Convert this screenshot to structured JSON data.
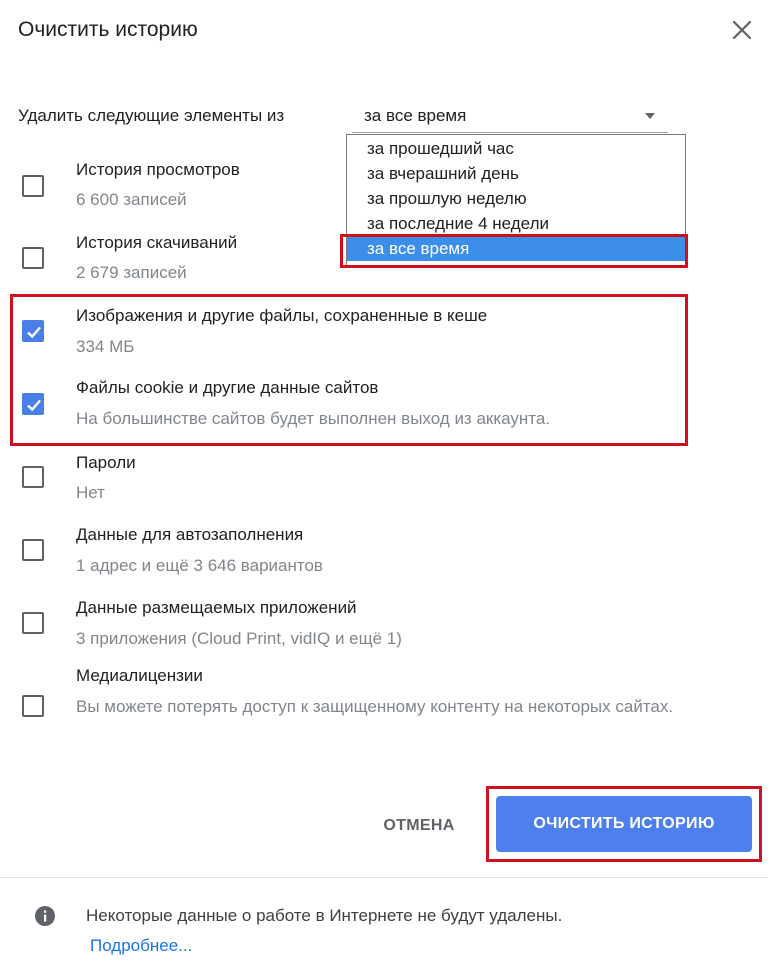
{
  "dialog": {
    "title": "Очистить историю",
    "close_icon": "close-icon"
  },
  "range": {
    "label": "Удалить следующие элементы из",
    "selected": "за все время",
    "options": [
      "за прошедший час",
      "за вчерашний день",
      "за прошлую неделю",
      "за последние 4 недели",
      "за все время"
    ],
    "selected_index": 4
  },
  "items": [
    {
      "title": "История просмотров",
      "subtitle": "6 600 записей",
      "checked": false
    },
    {
      "title": "История скачиваний",
      "subtitle": "2 679 записей",
      "checked": false
    },
    {
      "title": "Изображения и другие файлы, сохраненные в кеше",
      "subtitle": "334 МБ",
      "checked": true
    },
    {
      "title": "Файлы cookie и другие данные сайтов",
      "subtitle": "На большинстве сайтов будет выполнен выход из аккаунта.",
      "checked": true
    },
    {
      "title": "Пароли",
      "subtitle": "Нет",
      "checked": false
    },
    {
      "title": "Данные для автозаполнения",
      "subtitle": "1 адрес и ещё 3 646 вариантов",
      "checked": false
    },
    {
      "title": "Данные размещаемых приложений",
      "subtitle": "3 приложения (Cloud Print, vidIQ и ещё 1)",
      "checked": false
    },
    {
      "title": "Медиалицензии",
      "subtitle": "Вы можете потерять доступ к защищенному контенту на некоторых сайтах.",
      "checked": false
    }
  ],
  "buttons": {
    "cancel": "ОТМЕНА",
    "clear": "ОЧИСТИТЬ ИСТОРИЮ"
  },
  "footer": {
    "text": "Некоторые данные о работе в Интернете не будут удалены.",
    "link": "Подробнее..."
  },
  "colors": {
    "accent": "#4d7fef",
    "highlight": "#d0101f",
    "selected_option": "#3d8ee9"
  }
}
